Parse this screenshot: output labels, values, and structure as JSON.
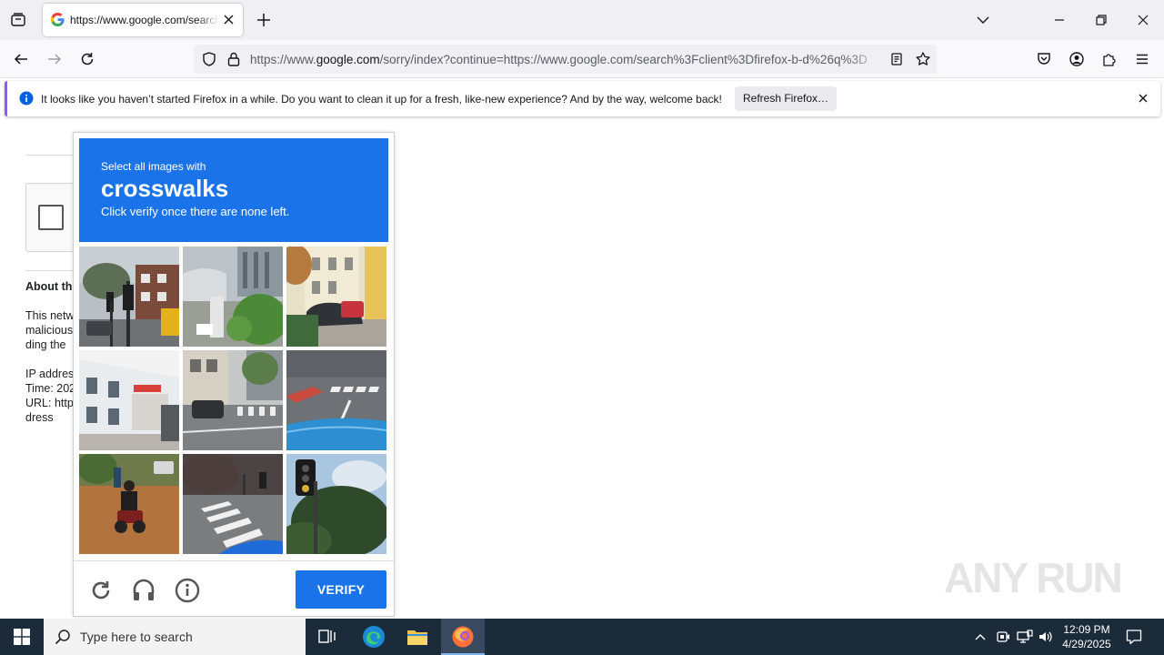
{
  "browser": {
    "tab_title": "https://www.google.com/search?client=firefox",
    "url_domain_prefix": "https://www.",
    "url_domain": "google.com",
    "url_rest": "/sorry/index?continue=https://www.google.com/search%3Fclient%3Dfirefox-b-d%26q%3D"
  },
  "notification": {
    "message": "It looks like you haven’t started Firefox in a while. Do you want to clean it up for a fresh, like-new experience? And by the way, welcome back!",
    "button_label": "Refresh Firefox…"
  },
  "background_page": {
    "about_heading": "About th",
    "text_lines": [
      "This netw",
      "malicious",
      "ding the"
    ],
    "info_lines": [
      "IP addres",
      "Time: 202",
      "URL: http",
      "dress"
    ]
  },
  "captcha": {
    "instruction_small": "Select all images with",
    "target_word": "crosswalks",
    "instruction_sub": "Click verify once there are none left.",
    "verify_label": "VERIFY"
  },
  "taskbar": {
    "search_placeholder": "Type here to search",
    "time": "12:09 PM",
    "date": "4/29/2025"
  },
  "watermark": "ANY RUN",
  "colors": {
    "captcha_blue": "#1a73e8",
    "taskbar_bg": "#1c2b3a",
    "notif_accent": "#8b5cf6"
  }
}
